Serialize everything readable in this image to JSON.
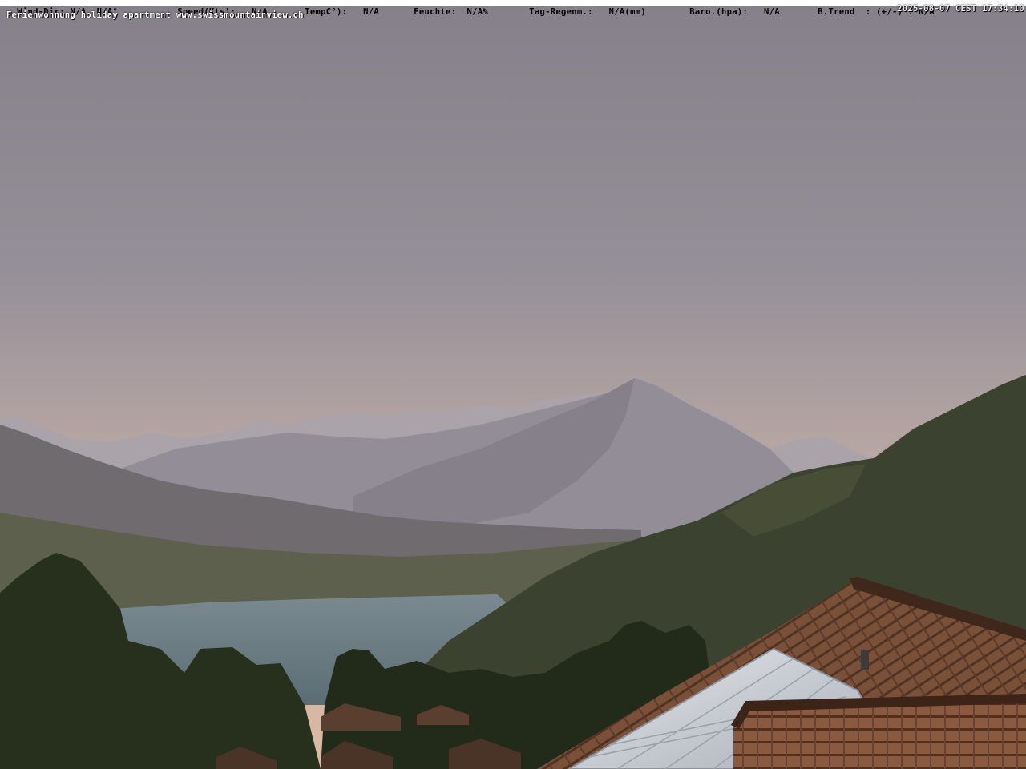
{
  "overlay": {
    "weather": [
      {
        "label": "Wind-Dir:",
        "value": "N/A  N/A°"
      },
      {
        "label": "Speed(Kts):",
        "value": "N/A"
      },
      {
        "label": "TempC°):",
        "value": "N/A"
      },
      {
        "label": "Feuchte:",
        "value": "N/A%"
      },
      {
        "label": "Tag-Regenm.:",
        "value": "N/A(mm)"
      },
      {
        "label": "Baro.(hpa):",
        "value": "N/A"
      },
      {
        "label": "B.Trend  : (+/-) :",
        "value": "N/A"
      }
    ],
    "subtitle": "Ferienwohnung holiday apartment www.swissmountainview.ch",
    "timestamp": "2025-08-07 CEST 17:34:10"
  },
  "colors": {
    "sky_top": "#8a8690",
    "sky_horizon": "#d8b8a4",
    "mountain_far": "#a49fa8",
    "mountain_mid": "#8d8893",
    "mountain_near": "#6e6a72",
    "valley": "#5d5f4c",
    "lake": "#6c8087",
    "forest": "#2b321f",
    "roof": "#6e4a36",
    "solar": "#c8ccd2"
  }
}
